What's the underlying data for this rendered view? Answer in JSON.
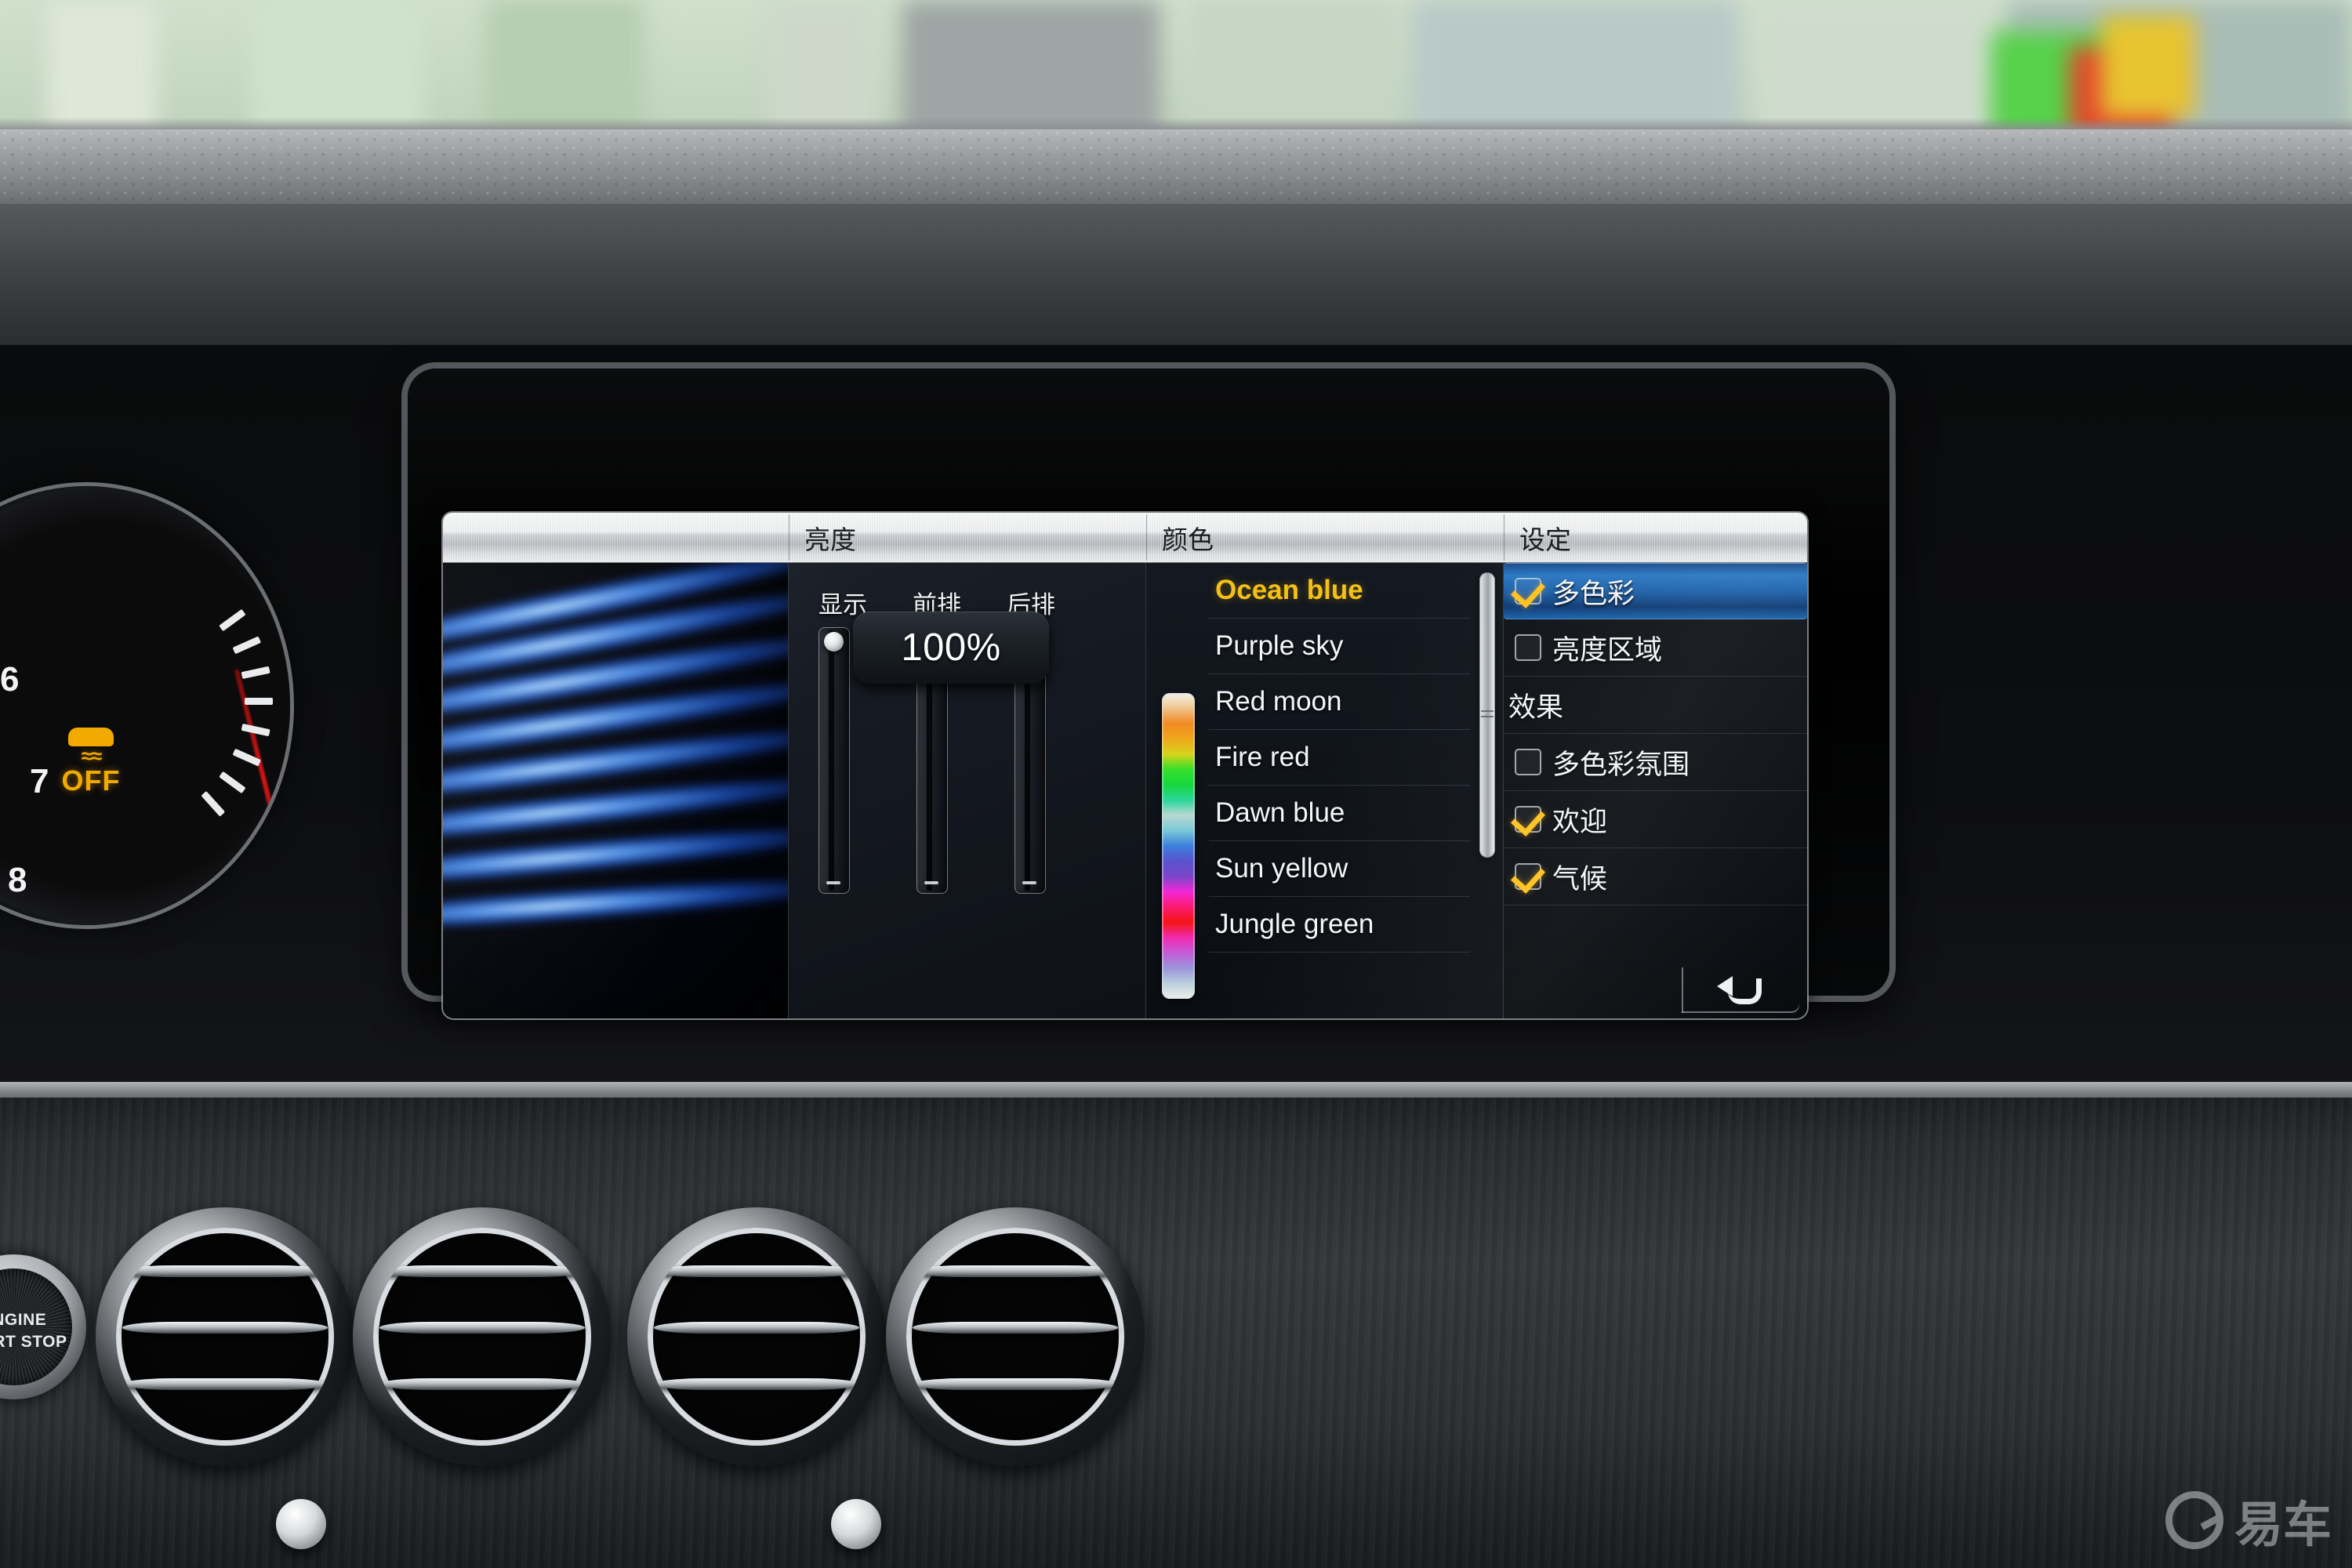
{
  "screen": {
    "tabs": [
      {
        "label": "",
        "name": "tab-animation"
      },
      {
        "label": "亮度",
        "name": "tab-brightness"
      },
      {
        "label": "颜色",
        "name": "tab-color"
      },
      {
        "label": "设定",
        "name": "tab-settings"
      }
    ]
  },
  "brightness": {
    "sliders": [
      {
        "label": "显示",
        "value": 100
      },
      {
        "label": "前排",
        "value": 100
      },
      {
        "label": "后排",
        "value": 100
      }
    ],
    "value_bubble": "100%"
  },
  "color": {
    "items": [
      {
        "label": "Ocean blue",
        "selected": true
      },
      {
        "label": "Purple sky",
        "selected": false
      },
      {
        "label": "Red moon",
        "selected": false
      },
      {
        "label": "Fire red",
        "selected": false
      },
      {
        "label": "Dawn blue",
        "selected": false
      },
      {
        "label": "Sun yellow",
        "selected": false
      },
      {
        "label": "Jungle green",
        "selected": false
      }
    ],
    "gradient_stops": [
      "#f2f2ea",
      "#f0c48c",
      "#f08a22",
      "#f0a81e",
      "#d7d41a",
      "#35e02a",
      "#17d73e",
      "#2ad79a",
      "#b9d8d2",
      "#79c8d8",
      "#3c7fdc",
      "#5a52cf",
      "#7a46c8",
      "#f327d8",
      "#fa1a6e",
      "#f51414",
      "#f22ab0",
      "#c35cd8",
      "#9a96d8",
      "#bcd0dd",
      "#eef0ea"
    ],
    "selected_color_hex": "#f5c015"
  },
  "settings": {
    "items": [
      {
        "label": "多色彩",
        "type": "checkbox",
        "checked": true,
        "highlighted": true
      },
      {
        "label": "亮度区域",
        "type": "checkbox",
        "checked": false,
        "highlighted": false
      },
      {
        "label": "效果",
        "type": "header",
        "checked": false,
        "highlighted": false
      },
      {
        "label": "多色彩氛围",
        "type": "checkbox",
        "checked": false,
        "highlighted": false
      },
      {
        "label": "欢迎",
        "type": "checkbox",
        "checked": true,
        "highlighted": false
      },
      {
        "label": "气候",
        "type": "checkbox",
        "checked": true,
        "highlighted": false
      }
    ],
    "back_icon": "back-arrow-icon",
    "highlight_color": "#2a78c4",
    "check_color": "#ffc21f"
  },
  "cluster": {
    "tick_numbers": [
      "6",
      "7",
      "8"
    ],
    "warning": {
      "icon": "esp-off-icon",
      "label": "OFF",
      "color": "#f2a900"
    }
  },
  "engine_button": {
    "label": "ENGINE\nSTART STOP"
  },
  "watermark": {
    "text": "易车",
    "icon": "yiche-logo-icon"
  }
}
